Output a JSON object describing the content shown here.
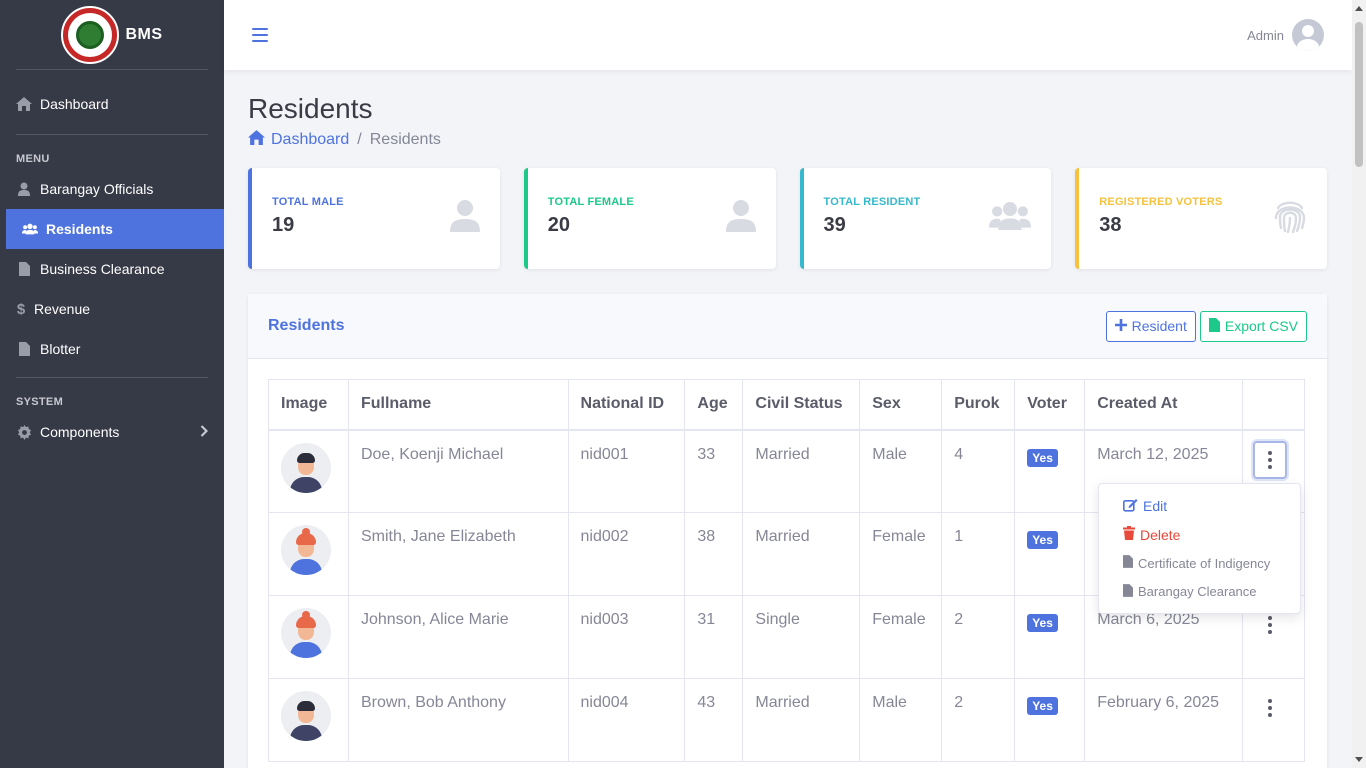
{
  "brand": {
    "name": "BMS"
  },
  "sidebar": {
    "dashboard": "Dashboard",
    "menu_heading": "MENU",
    "items": [
      {
        "label": "Barangay Officials",
        "icon": "user-tie-icon"
      },
      {
        "label": "Residents",
        "icon": "users-icon",
        "active": true
      },
      {
        "label": "Business Clearance",
        "icon": "file-icon"
      },
      {
        "label": "Revenue",
        "icon": "dollar-icon"
      },
      {
        "label": "Blotter",
        "icon": "file-icon"
      }
    ],
    "system_heading": "SYSTEM",
    "components": "Components"
  },
  "topbar": {
    "user_name": "Admin"
  },
  "page": {
    "title": "Residents",
    "breadcrumb_home": "Dashboard",
    "breadcrumb_current": "Residents"
  },
  "stats": [
    {
      "label": "TOTAL MALE",
      "value": "19",
      "color": "#4e73df"
    },
    {
      "label": "TOTAL FEMALE",
      "value": "20",
      "color": "#1cc88a"
    },
    {
      "label": "TOTAL RESIDENT",
      "value": "39",
      "color": "#36b9cc"
    },
    {
      "label": "REGISTERED VOTERS",
      "value": "38",
      "color": "#f6c23e"
    }
  ],
  "panel": {
    "title": "Residents",
    "add_button": "Resident",
    "export_button": "Export CSV"
  },
  "table": {
    "headers": [
      "Image",
      "Fullname",
      "National ID",
      "Age",
      "Civil Status",
      "Sex",
      "Purok",
      "Voter",
      "Created At",
      ""
    ],
    "rows": [
      {
        "fullname": "Doe, Koenji Michael",
        "national_id": "nid001",
        "age": "33",
        "civil_status": "Married",
        "sex": "Male",
        "purok": "4",
        "voter": "Yes",
        "created_at": "March 12, 2025"
      },
      {
        "fullname": "Smith, Jane Elizabeth",
        "national_id": "nid002",
        "age": "38",
        "civil_status": "Married",
        "sex": "Female",
        "purok": "1",
        "voter": "Yes",
        "created_at": ""
      },
      {
        "fullname": "Johnson, Alice Marie",
        "national_id": "nid003",
        "age": "31",
        "civil_status": "Single",
        "sex": "Female",
        "purok": "2",
        "voter": "Yes",
        "created_at": "March 6, 2025"
      },
      {
        "fullname": "Brown, Bob Anthony",
        "national_id": "nid004",
        "age": "43",
        "civil_status": "Married",
        "sex": "Male",
        "purok": "2",
        "voter": "Yes",
        "created_at": "February 6, 2025"
      }
    ]
  },
  "dropdown": {
    "edit": "Edit",
    "delete": "Delete",
    "indigency": "Certificate of Indigency",
    "clearance": "Barangay Clearance"
  }
}
